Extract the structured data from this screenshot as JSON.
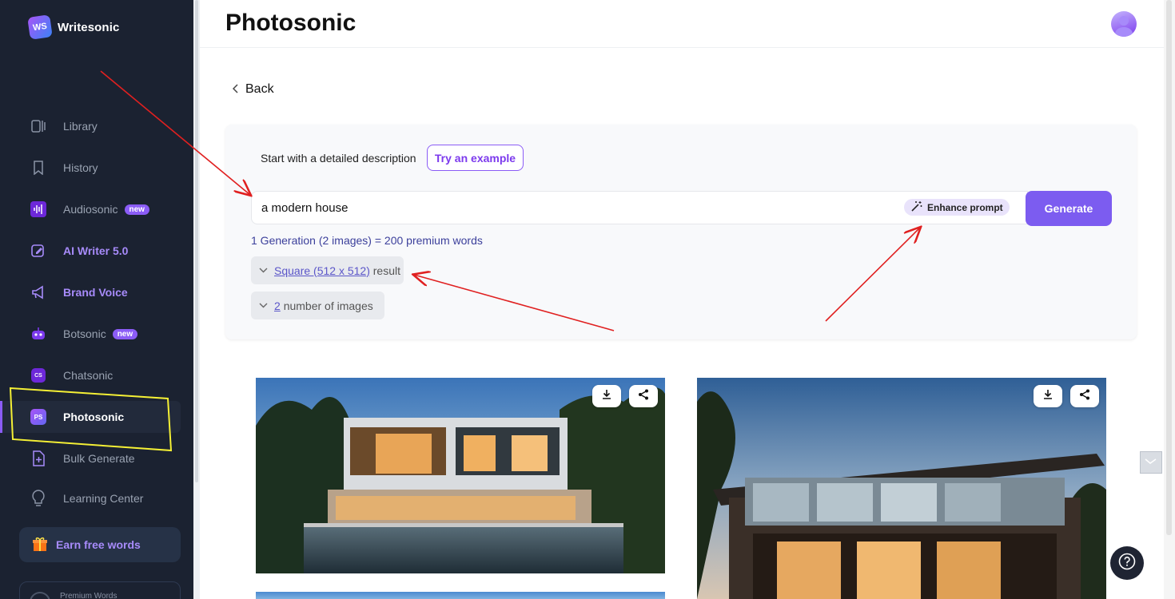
{
  "sidebar": {
    "logo_badge": "WS",
    "logo_text": "Writesonic",
    "items": [
      {
        "label": "Library",
        "icon": "library-icon"
      },
      {
        "label": "History",
        "icon": "bookmark-icon"
      },
      {
        "label": "Audiosonic",
        "icon": "audio-wave-icon",
        "badge": "new"
      },
      {
        "label": "AI Writer 5.0",
        "icon": "ai-writer-icon"
      },
      {
        "label": "Brand Voice",
        "icon": "megaphone-icon"
      },
      {
        "label": "Botsonic",
        "icon": "bot-icon",
        "badge": "new"
      },
      {
        "label": "Chatsonic",
        "icon": "chatsonic-icon",
        "icon_text": "CS"
      },
      {
        "label": "Photosonic",
        "icon": "photosonic-icon",
        "icon_text": "PS",
        "active": true
      },
      {
        "label": "Bulk Generate",
        "icon": "bulk-generate-icon"
      },
      {
        "label": "Learning Center",
        "icon": "lightbulb-icon"
      }
    ],
    "earn_label": "Earn free words",
    "premium_label": "Premium Words"
  },
  "header": {
    "title": "Photosonic"
  },
  "back_label": "Back",
  "prompt": {
    "label": "Start with a detailed description",
    "try_example": "Try an example",
    "value": "a modern house",
    "enhance_label": "Enhance prompt",
    "generate_label": "Generate",
    "generation_info": "1 Generation (2 images) = 200 premium words"
  },
  "options": {
    "size_link": "Square (512 x 512)",
    "size_suffix": "result",
    "count_link": "2",
    "count_suffix": "number of images"
  },
  "colors": {
    "accent": "#7c5cf0",
    "sidebar_bg": "#1b2231",
    "annotation_red": "#e02020",
    "annotation_yellow": "#f5f035"
  }
}
